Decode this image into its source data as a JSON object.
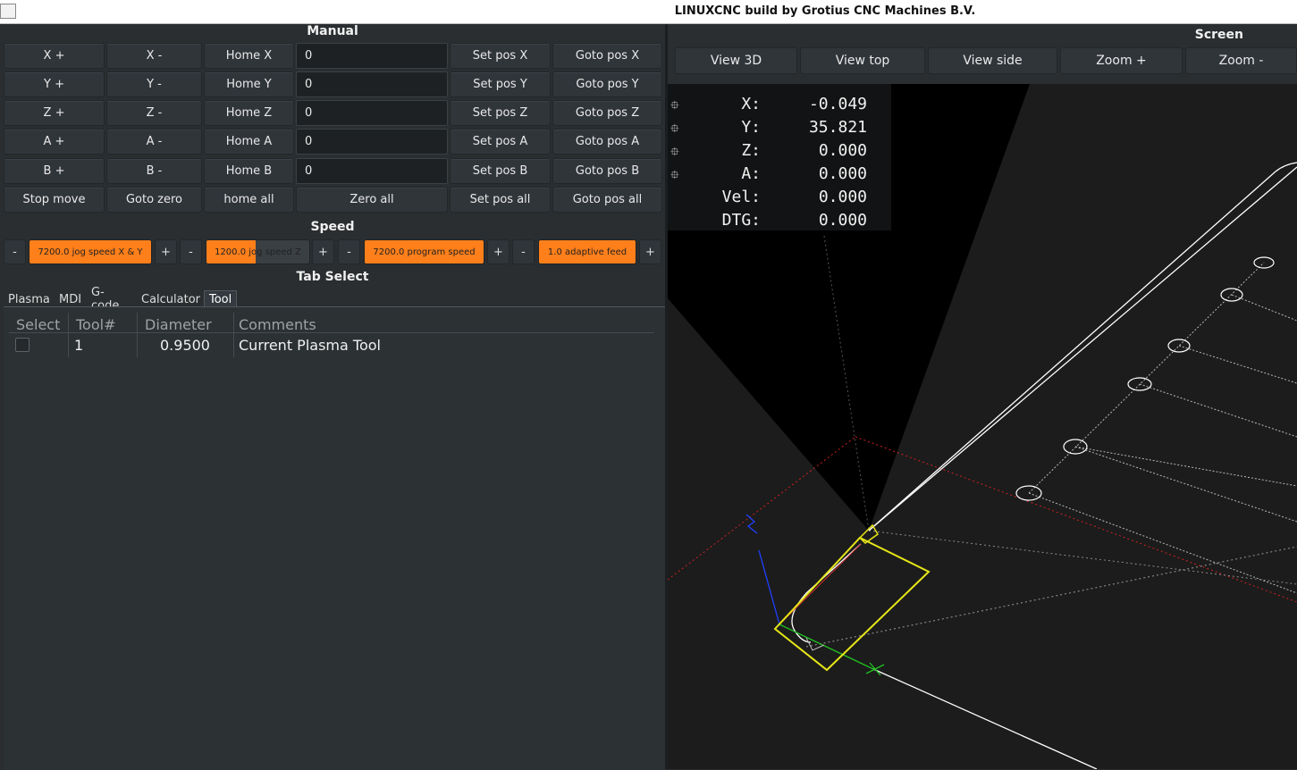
{
  "window": {
    "title": "LINUXCNC build by Grotius CNC Machines B.V."
  },
  "manual": {
    "title": "Manual",
    "rows": [
      {
        "plus": "X +",
        "minus": "X -",
        "home": "Home X",
        "value": "0",
        "set": "Set pos X",
        "goto": "Goto pos X"
      },
      {
        "plus": "Y +",
        "minus": "Y -",
        "home": "Home Y",
        "value": "0",
        "set": "Set pos Y",
        "goto": "Goto pos Y"
      },
      {
        "plus": "Z +",
        "minus": "Z -",
        "home": "Home Z",
        "value": "0",
        "set": "Set pos Z",
        "goto": "Goto pos Z"
      },
      {
        "plus": "A +",
        "minus": "A -",
        "home": "Home A",
        "value": "0",
        "set": "Set pos A",
        "goto": "Goto pos A"
      },
      {
        "plus": "B +",
        "minus": "B -",
        "home": "Home B",
        "value": "0",
        "set": "Set pos B",
        "goto": "Goto pos B"
      }
    ],
    "bottom": {
      "stop": "Stop move",
      "goto_zero": "Goto zero",
      "home_all": "home all",
      "zero_all": "Zero all",
      "set_all": "Set pos all",
      "goto_all": "Goto pos all"
    }
  },
  "speed": {
    "title": "Speed",
    "minus": "-",
    "plus": "+",
    "sliders": [
      {
        "label": "7200.0 jog speed X & Y",
        "fraction": 1.0
      },
      {
        "label": "1200.0 jog speed Z",
        "fraction": 0.48
      },
      {
        "label": "7200.0 program speed",
        "fraction": 1.0
      },
      {
        "label": "1.0 adaptive feed",
        "fraction": 1.0
      }
    ]
  },
  "tab_select": {
    "title": "Tab Select",
    "tabs": [
      "Plasma",
      "MDI",
      "G-code",
      "Calculator",
      "Tool"
    ],
    "active": "Tool"
  },
  "tool_table": {
    "headers": [
      "Select",
      "Tool#",
      "Diameter",
      "Comments"
    ],
    "rows": [
      {
        "tool": "1",
        "diameter": "0.9500",
        "comment": "Current Plasma Tool",
        "selected": false
      }
    ]
  },
  "screen": {
    "title": "Screen",
    "buttons": [
      "View 3D",
      "View top",
      "View side",
      "Zoom +",
      "Zoom -"
    ]
  },
  "dro": [
    {
      "label": "X:",
      "value": "-0.049",
      "icon": "homed-icon"
    },
    {
      "label": "Y:",
      "value": "35.821",
      "icon": "homed-icon"
    },
    {
      "label": "Z:",
      "value": "0.000",
      "icon": "homed-icon"
    },
    {
      "label": "A:",
      "value": "0.000",
      "icon": "homed-icon"
    },
    {
      "label": "Vel:",
      "value": "0.000",
      "icon": ""
    },
    {
      "label": "DTG:",
      "value": "0.000",
      "icon": ""
    }
  ],
  "colors": {
    "accent": "#ff7f1a",
    "background": "#2a2e30",
    "canvas": "#000000",
    "tool_yellow": "#e6e619"
  }
}
